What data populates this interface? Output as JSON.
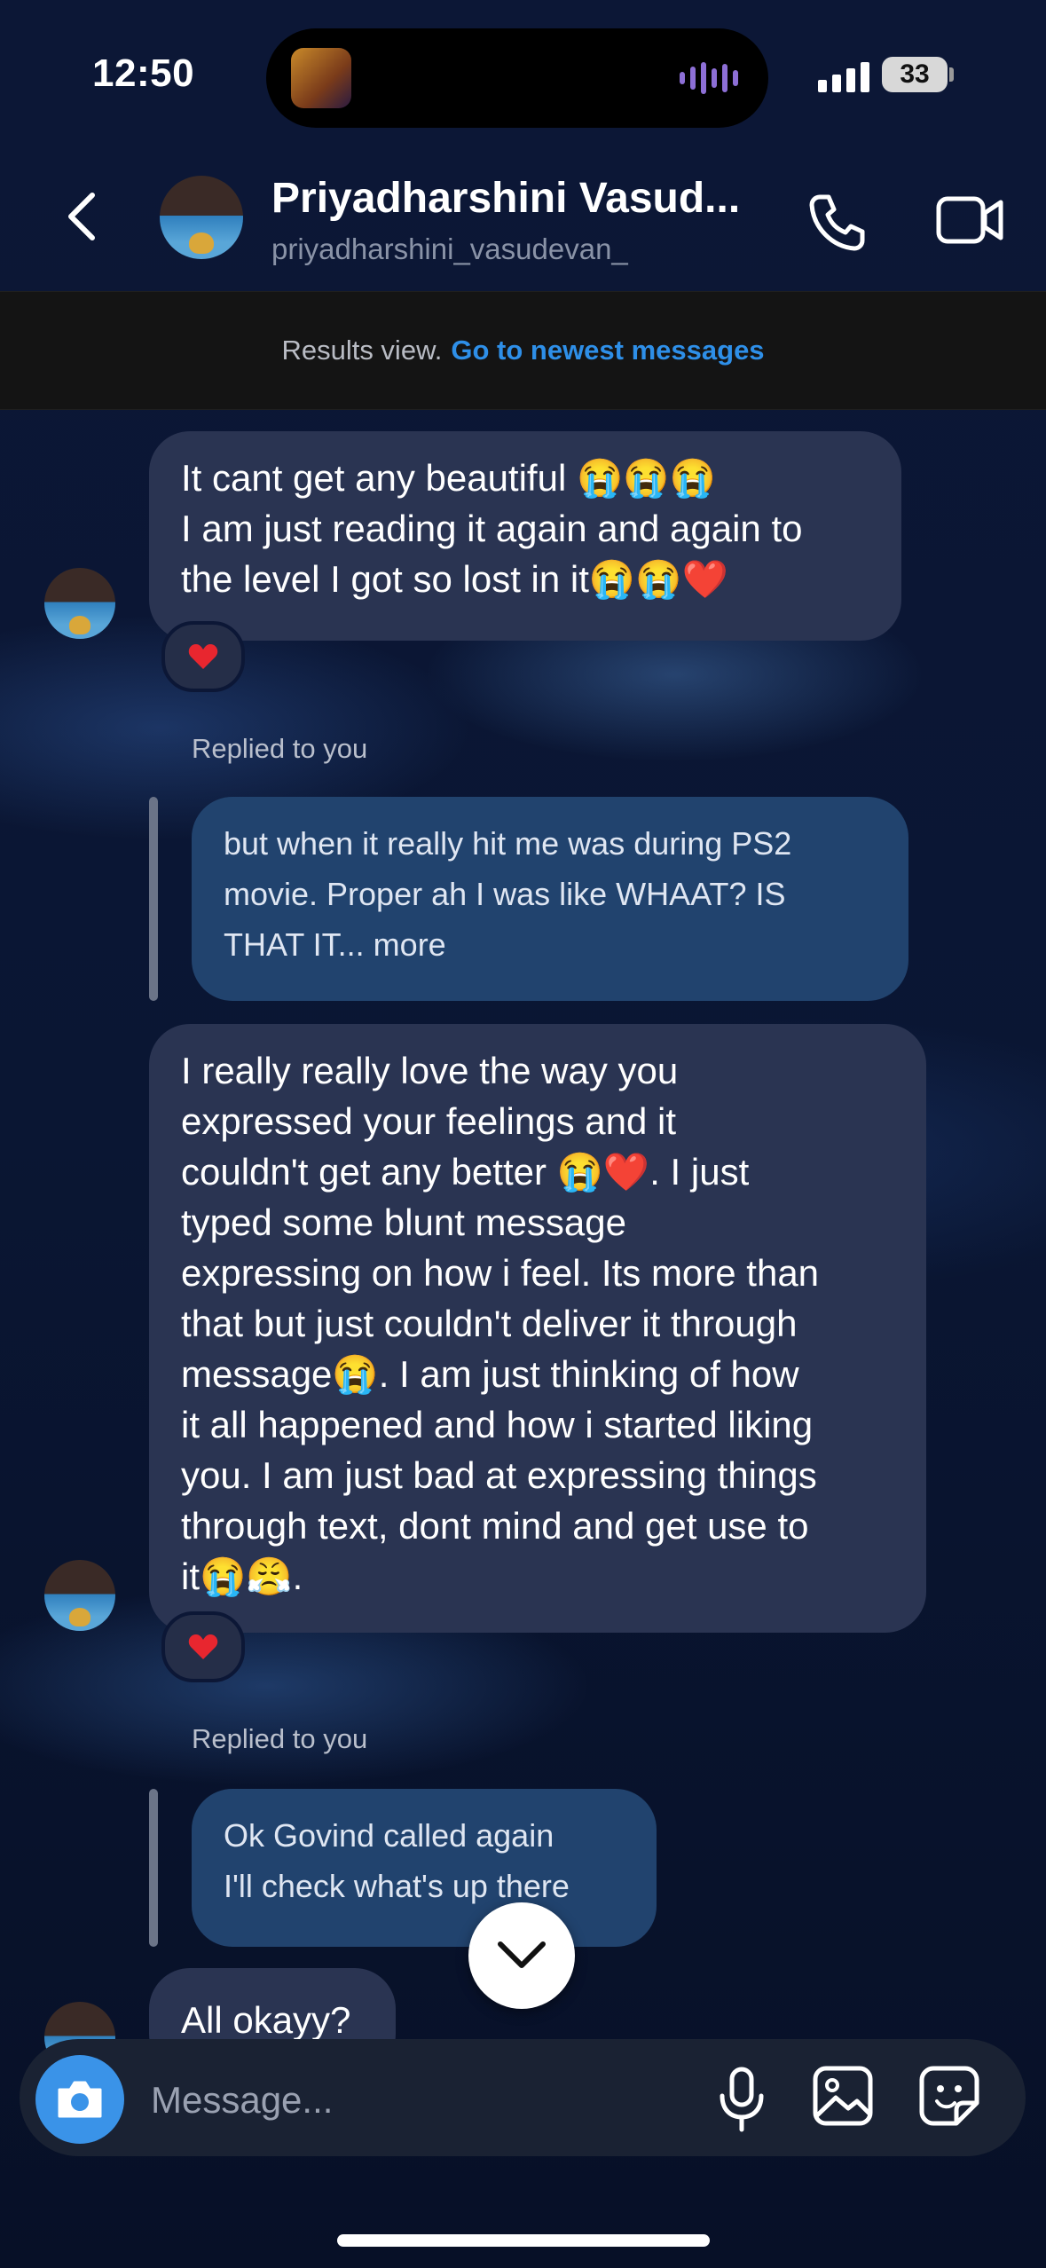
{
  "status_bar": {
    "time": "12:50",
    "battery": "33"
  },
  "header": {
    "name": "Priyadharshini Vasud...",
    "username": "priyadharshini_vasudevan_",
    "icons": [
      "chevron-left-icon",
      "phone-icon",
      "video-icon"
    ]
  },
  "banner": {
    "text": "Results view.",
    "link": "Go to newest messages"
  },
  "messages": [
    {
      "type": "incoming",
      "lines": [
        "It cant get any beautiful 😭😭😭",
        "I am just reading it again and again to",
        "the level I got so lost in it😭😭❤️"
      ],
      "reaction": "❤️"
    },
    {
      "type": "reply",
      "label": "Replied to you",
      "lines": [
        "but when it really hit me was during PS2",
        "movie. Proper ah I was like WHAAT? IS",
        "THAT IT... more"
      ]
    },
    {
      "type": "incoming",
      "lines": [
        "I really really love the way you",
        "expressed your feelings and it",
        "couldn't get any better 😭❤️. I just",
        "typed some blunt message",
        "expressing on how i feel. Its more than",
        "that but just couldn't deliver it through",
        "message😭. I am just thinking of how",
        "it all happened and how i started liking",
        "you. I am just bad at expressing things",
        "through text, dont mind and get use to",
        "it😭😤."
      ],
      "reaction": "❤️"
    },
    {
      "type": "reply",
      "label": "Replied to you",
      "lines": [
        "Ok Govind called again",
        "I'll check what's up there"
      ]
    },
    {
      "type": "incoming",
      "lines": [
        "All okayy?"
      ]
    }
  ],
  "composer": {
    "placeholder": "Message..."
  },
  "colors": {
    "accent": "#2e8fe8",
    "bubble_incoming": "#2a3452",
    "bubble_reply": "#21436e",
    "heart": "#e8262f"
  }
}
